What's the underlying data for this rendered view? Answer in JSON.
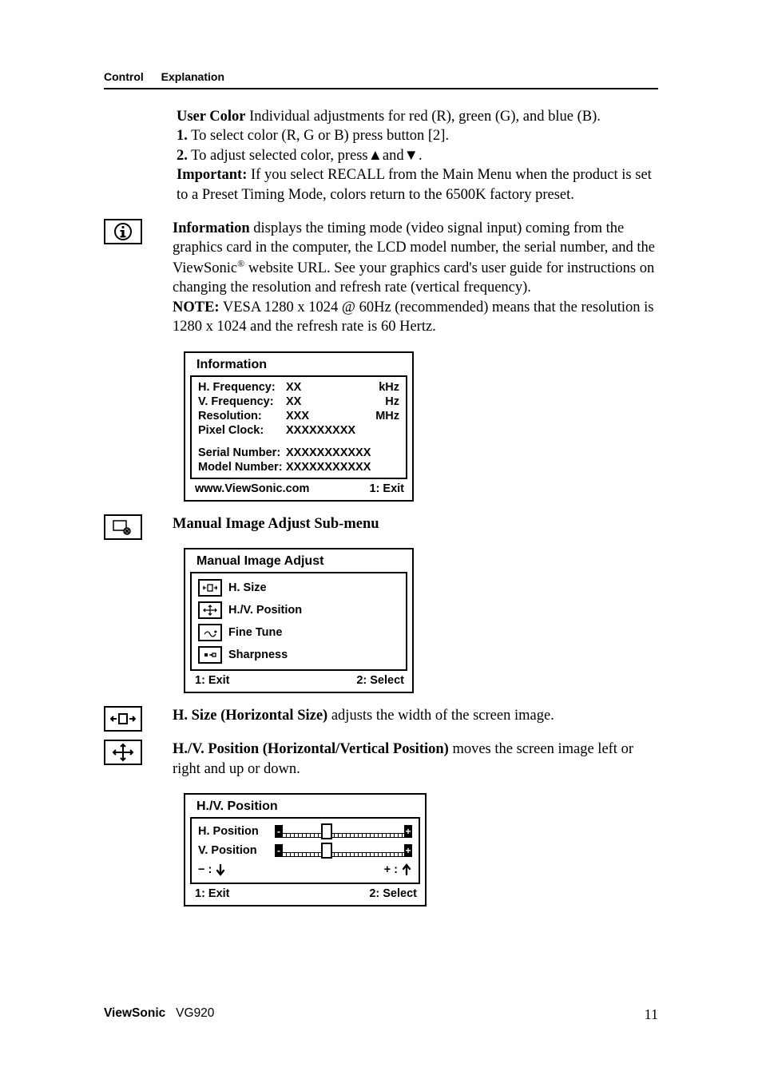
{
  "header": {
    "control": "Control",
    "explanation": "Explanation"
  },
  "user_color": {
    "label": "User Color",
    "desc": "  Individual adjustments for red (R), green (G),  and blue (B).",
    "step1_num": "1.",
    "step1": " To select color (R, G or B) press button [2].",
    "step2_num": "2.",
    "step2a": " To adjust selected color, press",
    "step2b": "and",
    "step2c": ".",
    "important_label": "Important:",
    "important": " If you select RECALL from the Main Menu when the product is set to a Preset Timing Mode, colors return to the 6500K factory preset."
  },
  "information": {
    "label": "Information",
    "desc": " displays the timing mode (video signal input) coming from the graphics card in the computer, the LCD model number, the serial number, and the ViewSonic",
    "desc2": " website URL. See your graphics card's user guide for instructions on changing the resolution and refresh rate (vertical frequency).",
    "note_label": "NOTE:",
    "note": " VESA 1280 x 1024 @ 60Hz (recommended) means that the resolution is 1280 x 1024 and the refresh rate is 60 Hertz."
  },
  "info_osd": {
    "title": "Information",
    "rows": [
      {
        "l": "H. Frequency:",
        "m": "XX",
        "r": "kHz"
      },
      {
        "l": "V. Frequency:",
        "m": "XX",
        "r": "Hz"
      },
      {
        "l": "Resolution:",
        "m": "XXX",
        "r": "MHz"
      },
      {
        "l": "Pixel Clock:",
        "m": "XXXXXXXXX",
        "r": ""
      }
    ],
    "serial_l": "Serial Number:",
    "serial_v": "XXXXXXXXXXX",
    "model_l": "Model Number:",
    "model_v": "XXXXXXXXXXX",
    "url": "www.ViewSonic.com",
    "exit": "1: Exit"
  },
  "mia_heading": "Manual Image Adjust Sub-menu",
  "mia_osd": {
    "title": "Manual Image Adjust",
    "items": [
      "H. Size",
      "H./V. Position",
      "Fine Tune",
      "Sharpness"
    ],
    "exit": "1: Exit",
    "select": "2: Select"
  },
  "hsize": {
    "label": "H. Size (Horizontal Size)",
    "desc": " adjusts the width of the screen image."
  },
  "hvpos": {
    "label": "H./V. Position (Horizontal/Vertical Position)",
    "desc": " moves the screen image left or right and up or down."
  },
  "hv_osd": {
    "title": "H./V. Position",
    "hpos": "H. Position",
    "vpos": "V. Position",
    "minus": "− :",
    "plus": "+ :",
    "exit": "1: Exit",
    "select": "2: Select"
  },
  "footer": {
    "brand": "ViewSonic",
    "model": "VG920",
    "page": "11"
  },
  "reg_mark": "®"
}
